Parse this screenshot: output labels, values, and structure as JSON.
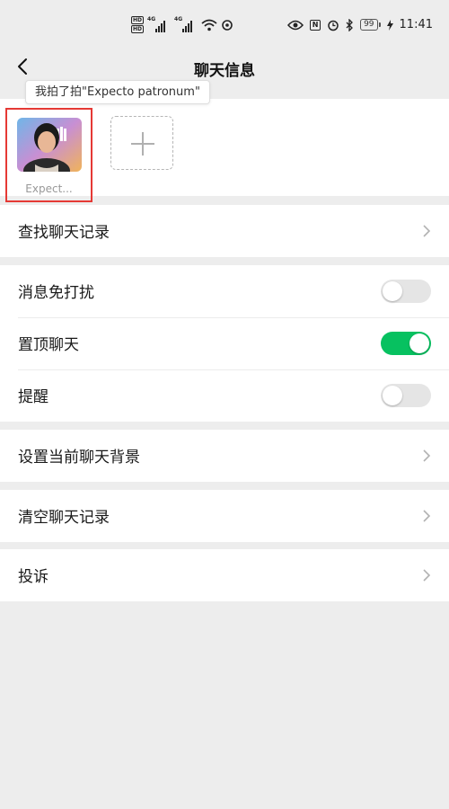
{
  "status_bar": {
    "hd1": "HD",
    "hd2": "HD",
    "net1": "4G",
    "net2": "4G",
    "nfc": "N",
    "battery": "99",
    "time": "11:41"
  },
  "header": {
    "title": "聊天信息"
  },
  "tooltip": {
    "text": "我拍了拍\"Expecto patronum\""
  },
  "members": {
    "items": [
      {
        "name": "Expect..."
      }
    ]
  },
  "settings": {
    "search_history": "查找聊天记录",
    "mute": "消息免打扰",
    "pin": "置顶聊天",
    "remind": "提醒",
    "background": "设置当前聊天背景",
    "clear_history": "清空聊天记录",
    "report": "投诉"
  },
  "toggles": {
    "mute": false,
    "pin": true,
    "remind": false
  },
  "colors": {
    "accent_green": "#07c160",
    "highlight_red": "#e53935",
    "page_bg": "#ededed"
  }
}
